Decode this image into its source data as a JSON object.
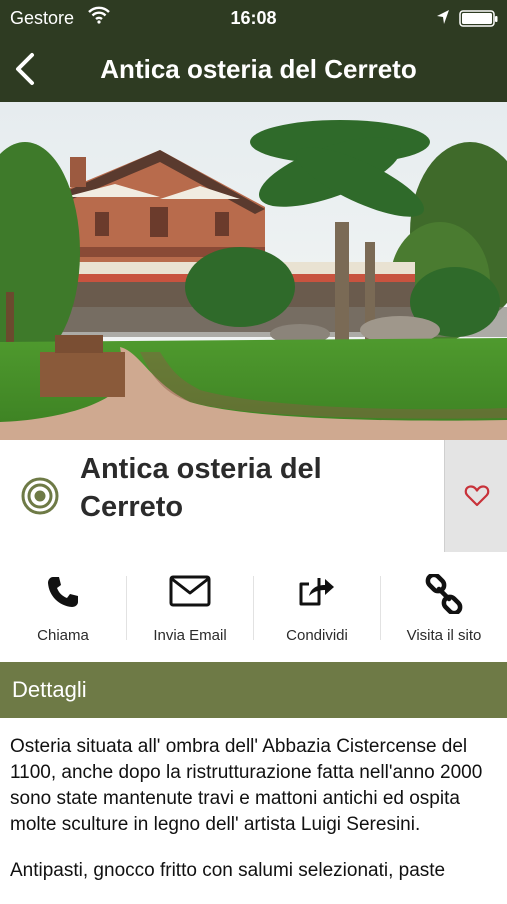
{
  "status_bar": {
    "carrier": "Gestore",
    "time": "16:08"
  },
  "nav": {
    "title": "Antica osteria del Cerreto"
  },
  "place": {
    "name": "Antica osteria del Cerreto"
  },
  "actions": [
    {
      "label": "Chiama"
    },
    {
      "label": "Invia Email"
    },
    {
      "label": "Condividi"
    },
    {
      "label": "Visita il sito"
    }
  ],
  "section": {
    "title": "Dettagli"
  },
  "details": {
    "paragraph_1": "Osteria situata all' ombra dell' Abbazia Cistercense del 1100, anche dopo la ristrutturazione fatta nell'anno 2000 sono state mantenute travi e mattoni antichi ed ospita molte sculture in legno dell' artista Luigi Seresini.",
    "paragraph_2": "Antipasti, gnocco fritto con salumi selezionati, paste"
  },
  "colors": {
    "nav_bg": "#2e3b22",
    "section_bg": "#6e7a46",
    "heart": "#c8323a"
  }
}
